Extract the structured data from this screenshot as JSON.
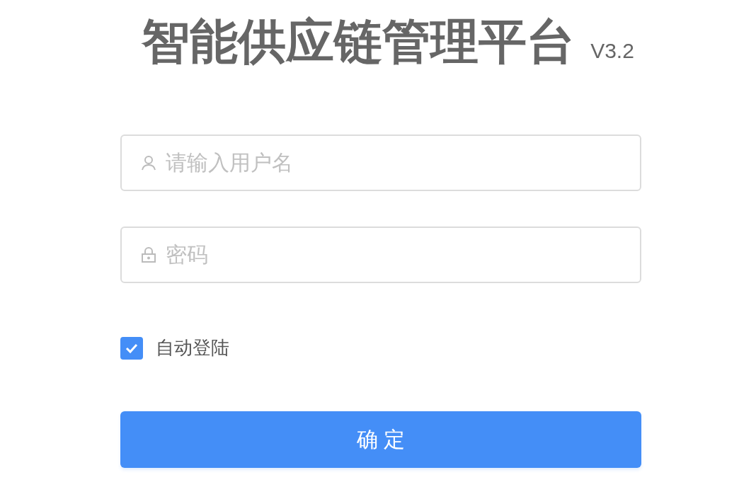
{
  "header": {
    "title": "智能供应链管理平台",
    "version": "V3.2"
  },
  "form": {
    "username": {
      "placeholder": "请输入用户名"
    },
    "password": {
      "placeholder": "密码"
    },
    "auto_login": {
      "label": "自动登陆",
      "checked": true
    },
    "submit": {
      "label": "确 定"
    }
  }
}
